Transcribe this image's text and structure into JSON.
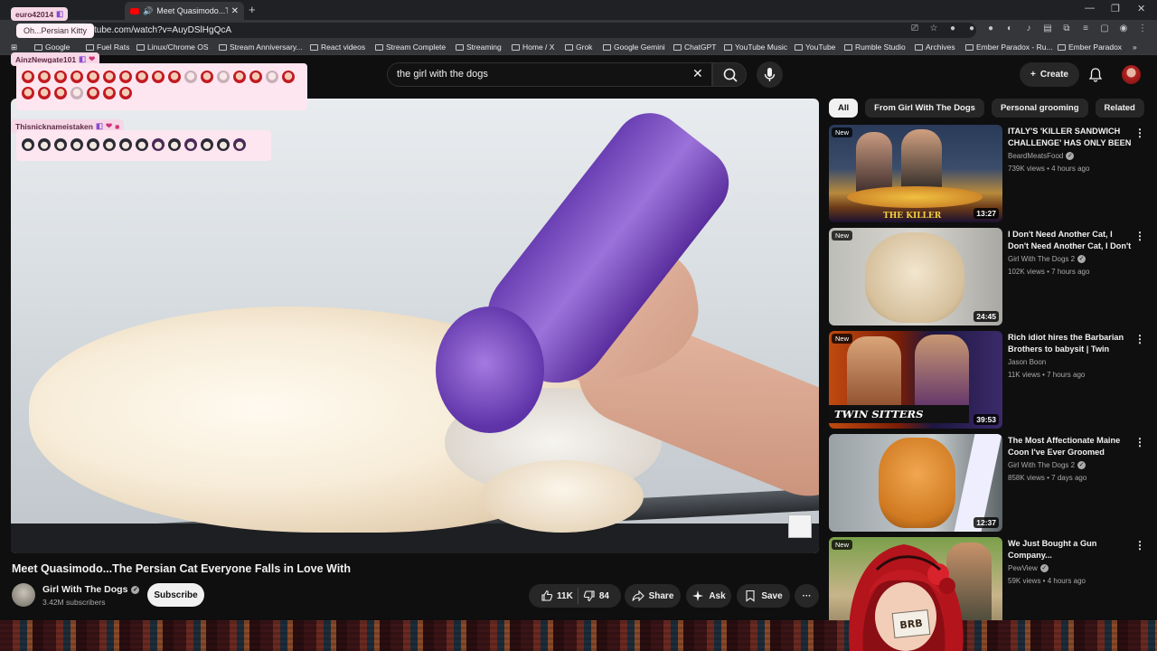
{
  "browser": {
    "tab_title": "Meet Quasimodo...The",
    "new_tab": "+",
    "url": "tube.com/watch?v=AuyDSlHgQcA",
    "bookmarks": [
      "Google",
      "Fuel Rats",
      "Linux/Chrome OS",
      "Stream Anniversary...",
      "React videos",
      "Stream Complete",
      "Streaming",
      "Home / X",
      "Grok",
      "Google Gemini",
      "ChatGPT",
      "YouTube Music",
      "YouTube",
      "Rumble Studio",
      "Archives",
      "Ember Paradox - Ru...",
      "Ember Paradox"
    ]
  },
  "youtube": {
    "search_query": "the girl with the dogs",
    "create_label": "Create",
    "video_title": "Meet Quasimodo...The Persian Cat Everyone Falls in Love With",
    "channel_name": "Girl With The Dogs",
    "subscribers": "3.42M subscribers",
    "subscribe_label": "Subscribe",
    "likes": "11K",
    "dislikes": "84",
    "share_label": "Share",
    "ask_label": "Ask",
    "save_label": "Save",
    "more_label": "···"
  },
  "sidebar": {
    "chips": [
      "All",
      "From Girl With The Dogs",
      "Personal grooming",
      "Related"
    ],
    "videos": [
      {
        "title": "ITALY'S 'KILLER SANDWICH CHALLENGE' HAS ONLY BEEN ...",
        "channel": "BeardMeatsFood",
        "meta": "739K views • 4 hours ago",
        "badge": "New",
        "duration": "13:27",
        "thumb_label": "THE KILLER"
      },
      {
        "title": "I Don't Need Another Cat, I Don't Need Another Cat, I Don't Need...",
        "channel": "Girl With The Dogs 2",
        "meta": "102K views • 7 hours ago",
        "badge": "New",
        "duration": "24:45",
        "thumb_label": ""
      },
      {
        "title": "Rich idiot hires the Barbarian Brothers to babysit | Twin Sitters",
        "channel": "Jason Boon",
        "meta": "11K views • 7 hours ago",
        "badge": "New",
        "duration": "39:53",
        "thumb_label": "TWIN SITTERS"
      },
      {
        "title": "The Most Affectionate Maine Coon I've Ever Groomed",
        "channel": "Girl With The Dogs 2",
        "meta": "858K views • 7 days ago",
        "badge": "",
        "duration": "12:37",
        "thumb_label": ""
      },
      {
        "title": "We Just Bought a Gun Company...",
        "channel": "PewView",
        "meta": "59K views • 4 hours ago",
        "badge": "New",
        "duration": "",
        "thumb_label": ""
      }
    ]
  },
  "overlay": {
    "chat": [
      {
        "user": "euro42014",
        "text": "Oh...Persian Kitty"
      },
      {
        "user": "AinzNewgate101",
        "text": ""
      },
      {
        "user": "Thisnicknameistaken",
        "text": ""
      }
    ],
    "brb": "BRB",
    "chat_color": "#f6d7e6"
  }
}
